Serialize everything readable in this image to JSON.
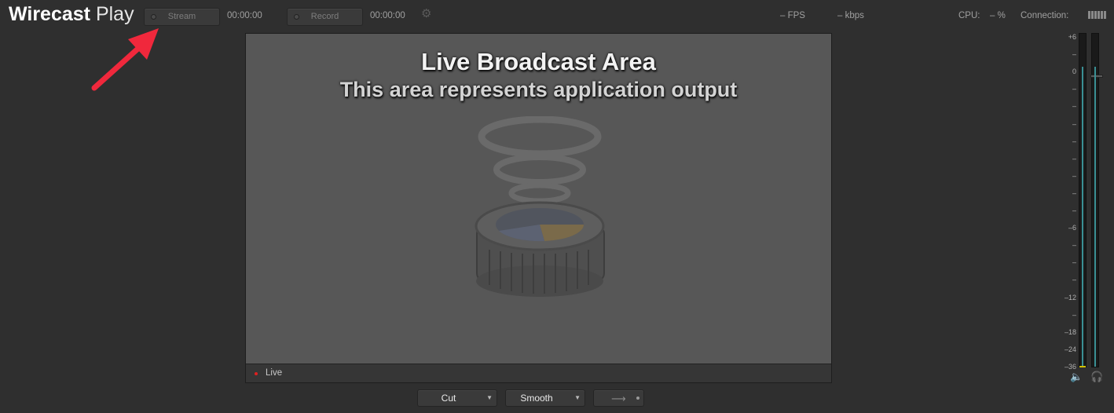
{
  "app": {
    "brand_bold": "Wirecast",
    "brand_light": "Play"
  },
  "toolbar": {
    "stream_label": "Stream",
    "stream_timer": "00:00:00",
    "record_label": "Record",
    "record_timer": "00:00:00",
    "fps": "– FPS",
    "kbps": "– kbps",
    "cpu_label": "CPU:",
    "cpu_value": "– %",
    "connection_label": "Connection:"
  },
  "preview": {
    "title": "Live Broadcast Area",
    "subtitle": "This area represents application output",
    "status_label": "Live",
    "status_color": "#e02020"
  },
  "controls": {
    "transition_cut": "Cut",
    "transition_smooth": "Smooth",
    "go_icon": "arrow-right-icon"
  },
  "audio_meter": {
    "scale": [
      "+6",
      "–",
      "0",
      "–",
      "–",
      "–",
      "–",
      "–",
      "–",
      "–",
      "–",
      "–6",
      "–",
      "–",
      "–",
      "–12",
      "–",
      "–18",
      "–24",
      "–36"
    ],
    "level": 0.9,
    "accent_color": "#3a8f94"
  },
  "icons": [
    "gear-icon",
    "speaker-icon",
    "headphones-icon",
    "arrow-right-icon"
  ]
}
